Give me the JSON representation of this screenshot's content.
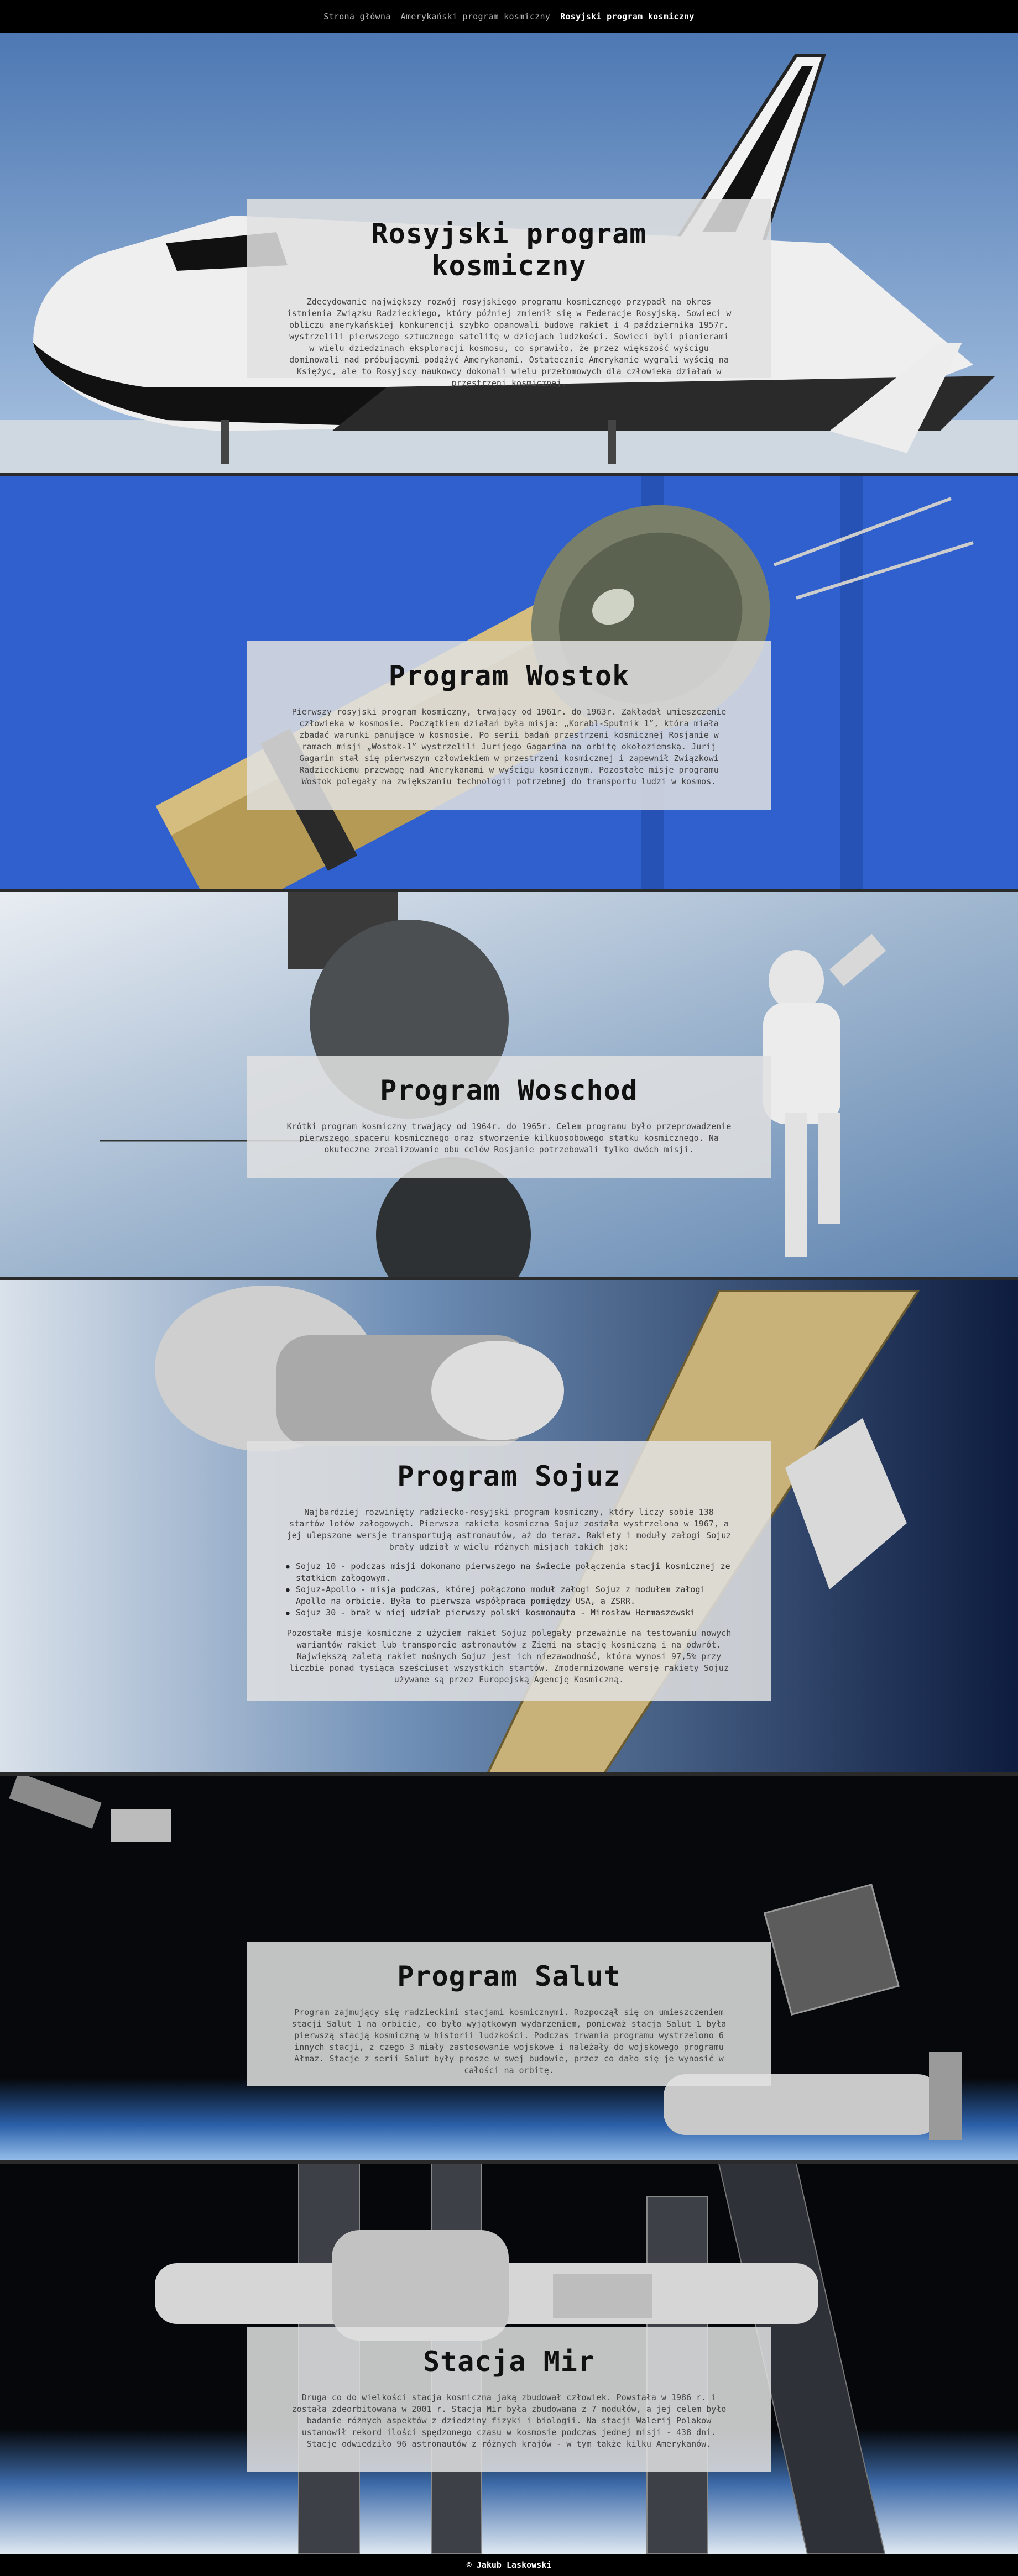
{
  "nav": {
    "items": [
      {
        "label": "Strona główna"
      },
      {
        "label": "Amerykański program kosmiczny"
      },
      {
        "label": "Rosyjski program kosmiczny"
      }
    ]
  },
  "sections": {
    "intro": {
      "title": "Rosyjski program kosmiczny",
      "text": "Zdecydowanie największy rozwój rosyjskiego programu kosmicznego przypadł na okres istnienia Związku Radzieckiego, który później zmienił się w Federacje Rosyjską. Sowieci w obliczu amerykańskiej konkurencji szybko opanowali budowę rakiet i 4 października 1957r. wystrzelili pierwszego sztucznego satelitę w dziejach ludzkości. Sowieci byli pionierami w wielu dziedzinach eksploracji kosmosu, co sprawiło, że przez większość wyścigu dominowali nad próbującymi podążyć Amerykanami. Ostatecznie Amerykanie wygrali wyścig na Księżyc, ale to Rosyjscy naukowcy dokonali wielu przełomowych dla człowieka działań w przestrzeni kosmicznej."
    },
    "wostok": {
      "title": "Program Wostok",
      "text": "Pierwszy rosyjski program kosmiczny, trwający od 1961r. do 1963r. Zakładał umieszczenie człowieka w kosmosie. Początkiem działań była misja: „Korabl-Sputnik 1”, która miała zbadać warunki panujące w kosmosie. Po serii badań przestrzeni kosmicznej Rosjanie w ramach misji „Wostok-1” wystrzelili Jurijego Gagarina na orbitę okołoziemską. Jurij Gagarin stał się pierwszym człowiekiem w przestrzeni kosmicznej i zapewnił Związkowi Radzieckiemu przewagę nad Amerykanami w wyścigu kosmicznym. Pozostałe misje programu Wostok polegały na zwiększaniu technologii potrzebnej do transportu ludzi w kosmos."
    },
    "woschod": {
      "title": "Program Woschod",
      "text": "Krótki program kosmiczny trwający od 1964r. do 1965r. Celem programu było przeprowadzenie pierwszego spaceru kosmicznego oraz stworzenie kilkuosobowego statku kosmicznego. Na okuteczne zrealizowanie obu celów Rosjanie potrzebowali tylko dwóch misji."
    },
    "sojuz": {
      "title": "Program Sojuz",
      "text": "Najbardziej rozwinięty radziecko-rosyjski program kosmiczny, który liczy sobie 138 startów lotów załogowych. Pierwsza rakieta kosmiczna Sojuz została wystrzelona w 1967, a jej ulepszone wersje transportują astronautów, aż do teraz. Rakiety i moduły załogi Sojuz brały udział w wielu różnych misjach takich jak:",
      "list": [
        "Sojuz 10 - podczas misji dokonano pierwszego na świecie połączenia stacji kosmicznej ze statkiem załogowym.",
        "Sojuz-Apollo - misja podczas, której połączono moduł załogi Sojuz z modułem załogi Apollo na orbicie. Była to pierwsza współpraca pomiędzy USA, a ZSRR.",
        "Sojuz 30 - brał w niej udział pierwszy polski kosmonauta - Mirosław Hermaszewski"
      ],
      "text2": "Pozostałe misje kosmiczne z użyciem rakiet Sojuz polegały przeważnie na testowaniu nowych wariantów rakiet lub transporcie astronautów z Ziemi na stację kosmiczną i na odwrót. Największą zaletą rakiet nośnych Sojuz jest ich niezawodność, która wynosi 97,5% przy liczbie ponad tysiąca sześciuset wszystkich startów. Zmodernizowane wersję rakiety Sojuz używane są przez Europejską Agencję Kosmiczną."
    },
    "salut": {
      "title": "Program Salut",
      "text": "Program zajmujący się radzieckimi stacjami kosmicznymi. Rozpoczął się on umieszczeniem stacji Salut 1 na orbicie, co było wyjątkowym wydarzeniem, ponieważ stacja Salut 1 była pierwszą stacją kosmiczną w historii ludzkości. Podczas trwania programu wystrzelono 6 innych stacji, z czego 3 miały zastosowanie wojskowe i należały do wojskowego programu Ałmaz. Stacje z serii Salut były prosze w swej budowie, przez co dało się je wynosić w całości na orbitę."
    },
    "mir": {
      "title": "Stacja Mir",
      "text": "Druga co do wielkości stacja kosmiczna jaką zbudował człowiek. Powstała w 1986 r. i została zdeorbitowana w 2001 r. Stacja Mir była zbudowana z 7 modułów, a jej celem było badanie różnych aspektów z dziedziny fizyki i biologii. Na stacji Walerij Polakow ustanowił rekord ilości spędzonego czasu w kosmosie podczas jednej misji - 438 dni. Stację odwiedziło 96 astronautów z różnych krajów - w tym także kilku Amerykanów."
    }
  },
  "footer": {
    "text": "© Jakub Laskowski"
  },
  "colors": {
    "nav_bg": "#000000",
    "card_bg": "#e1e1e1",
    "footer_bg": "#000000"
  }
}
